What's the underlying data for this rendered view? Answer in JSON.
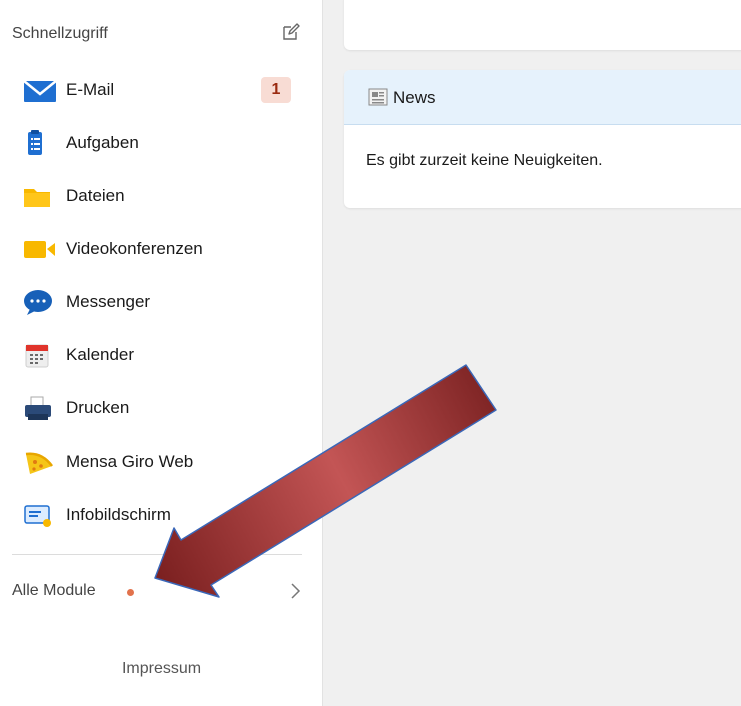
{
  "sidebar": {
    "title": "Schnellzugriff",
    "items": [
      {
        "label": "E-Mail",
        "icon": "mail-icon",
        "badge": "1"
      },
      {
        "label": "Aufgaben",
        "icon": "clipboard-icon"
      },
      {
        "label": "Dateien",
        "icon": "folder-icon"
      },
      {
        "label": "Videokonferenzen",
        "icon": "video-camera-icon"
      },
      {
        "label": "Messenger",
        "icon": "chat-bubble-icon"
      },
      {
        "label": "Kalender",
        "icon": "calendar-icon"
      },
      {
        "label": "Drucken",
        "icon": "printer-icon"
      },
      {
        "label": "Mensa Giro Web",
        "icon": "pizza-slice-icon"
      },
      {
        "label": "Infobildschirm",
        "icon": "info-screen-icon"
      }
    ],
    "all_modules": "Alle Module",
    "impressum": "Impressum"
  },
  "news": {
    "title": "News",
    "empty_text": "Es gibt zurzeit keine Neuigkeiten."
  },
  "colors": {
    "accent_blue": "#1f6fd1",
    "badge_bg": "#f8dcd4",
    "badge_text": "#9a2a10",
    "notification_dot": "#e2724c",
    "arrow": "#9b2f2f"
  }
}
